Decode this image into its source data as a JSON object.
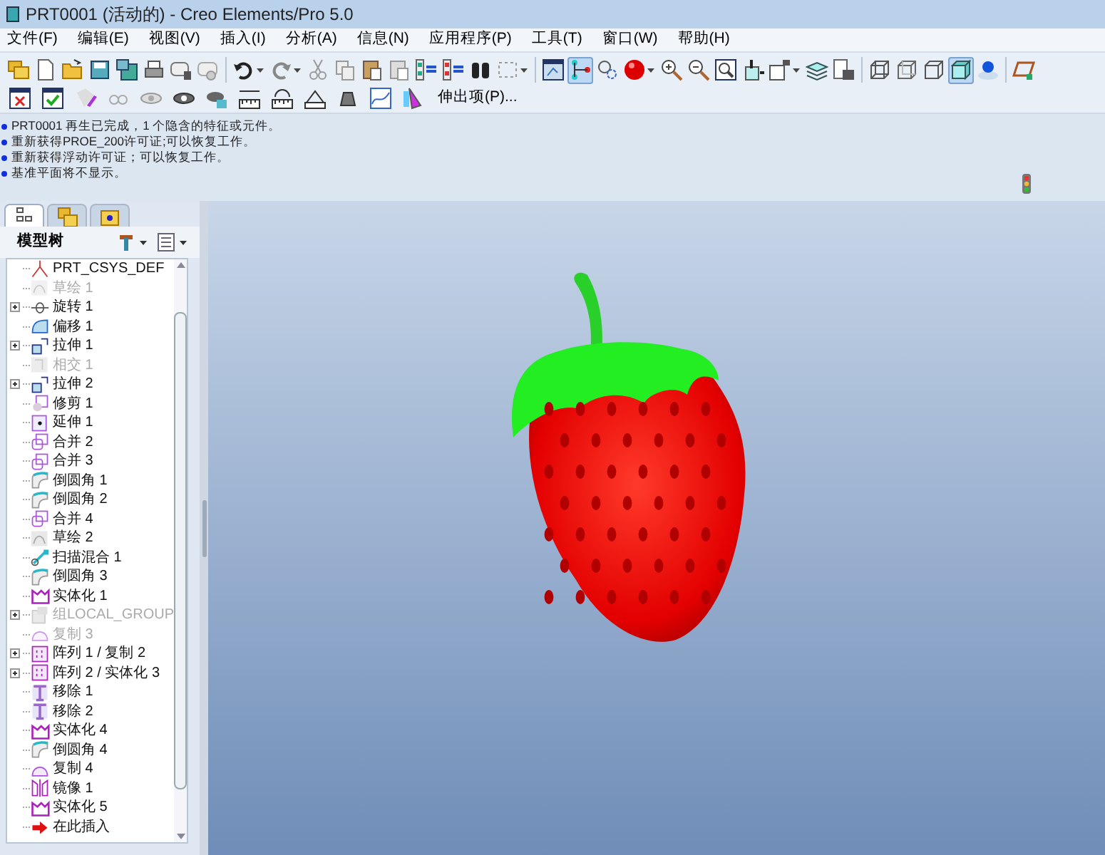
{
  "window": {
    "title": "PRT0001 (活动的) - Creo Elements/Pro 5.0"
  },
  "menu": [
    "文件(F)",
    "编辑(E)",
    "视图(V)",
    "插入(I)",
    "分析(A)",
    "信息(N)",
    "应用程序(P)",
    "工具(T)",
    "窗口(W)",
    "帮助(H)"
  ],
  "toolbar_1": [
    {
      "selected": false
    },
    {
      "selected": false
    },
    {
      "selected": false
    },
    {
      "selected": false
    },
    {
      "selected": false
    },
    {
      "selected": false
    },
    {
      "selected": false
    },
    {
      "selected": false
    },
    {
      "selected": false
    },
    {
      "selected": false
    },
    {
      "selected": false
    },
    {
      "selected": false
    },
    {
      "selected": false
    },
    {
      "selected": false
    },
    {
      "selected": false
    },
    {
      "selected": false
    },
    {
      "selected": false
    },
    {
      "selected": false
    },
    {
      "selected": false
    },
    {
      "selected": true
    },
    {
      "selected": false
    },
    {
      "selected": false
    },
    {
      "selected": false
    },
    {
      "selected": false
    },
    {
      "selected": false
    },
    {
      "selected": false
    },
    {
      "selected": false
    },
    {
      "selected": false
    },
    {
      "selected": false
    },
    {
      "selected": false
    },
    {
      "selected": false
    },
    {
      "selected": false
    },
    {
      "selected": true
    },
    {
      "selected": false
    },
    {
      "selected": false
    }
  ],
  "toolbar_2": {
    "menu_label": "伸出项(P)..."
  },
  "messages": [
    "PRT0001 再生已完成，1 个隐含的特征或元件。",
    "重新获得PROE_200许可证;可以恢复工作。",
    "重新获得浮动许可证；可以恢复工作。",
    "基准平面将不显示。"
  ],
  "model_tree": {
    "title": "模型树",
    "tabs": [
      {
        "selected": true
      },
      {
        "selected": false
      },
      {
        "selected": false
      }
    ],
    "items": [
      {
        "label": "PRT_CSYS_DEF",
        "kind": "csys",
        "expandable": false,
        "disabled": false
      },
      {
        "label": "草绘 1",
        "kind": "sketch",
        "expandable": false,
        "disabled": true
      },
      {
        "label": "旋转 1",
        "kind": "revolve",
        "expandable": true,
        "disabled": false
      },
      {
        "label": "偏移 1",
        "kind": "offset",
        "expandable": false,
        "disabled": false
      },
      {
        "label": "拉伸 1",
        "kind": "extrude",
        "expandable": true,
        "disabled": false
      },
      {
        "label": "相交 1",
        "kind": "intersect",
        "expandable": false,
        "disabled": true
      },
      {
        "label": "拉伸 2",
        "kind": "extrude",
        "expandable": true,
        "disabled": false
      },
      {
        "label": "修剪 1",
        "kind": "trim",
        "expandable": false,
        "disabled": false
      },
      {
        "label": "延伸 1",
        "kind": "extend",
        "expandable": false,
        "disabled": false
      },
      {
        "label": "合并 2",
        "kind": "merge",
        "expandable": false,
        "disabled": false
      },
      {
        "label": "合并 3",
        "kind": "merge",
        "expandable": false,
        "disabled": false
      },
      {
        "label": "倒圆角 1",
        "kind": "round",
        "expandable": false,
        "disabled": false
      },
      {
        "label": "倒圆角 2",
        "kind": "round",
        "expandable": false,
        "disabled": false
      },
      {
        "label": "合并 4",
        "kind": "merge",
        "expandable": false,
        "disabled": false
      },
      {
        "label": "草绘 2",
        "kind": "sketch",
        "expandable": false,
        "disabled": false
      },
      {
        "label": "扫描混合 1",
        "kind": "sweep",
        "expandable": false,
        "disabled": false
      },
      {
        "label": "倒圆角 3",
        "kind": "round",
        "expandable": false,
        "disabled": false
      },
      {
        "label": "实体化 1",
        "kind": "solidify",
        "expandable": false,
        "disabled": false
      },
      {
        "label": "组LOCAL_GROUP",
        "kind": "group",
        "expandable": true,
        "disabled": true
      },
      {
        "label": "复制 3",
        "kind": "copy",
        "expandable": false,
        "disabled": true
      },
      {
        "label": "阵列 1 / 复制 2",
        "kind": "pattern",
        "expandable": true,
        "disabled": false
      },
      {
        "label": "阵列 2 / 实体化 3",
        "kind": "pattern",
        "expandable": true,
        "disabled": false
      },
      {
        "label": "移除 1",
        "kind": "remove",
        "expandable": false,
        "disabled": false
      },
      {
        "label": "移除 2",
        "kind": "remove",
        "expandable": false,
        "disabled": false
      },
      {
        "label": "实体化 4",
        "kind": "solidify",
        "expandable": false,
        "disabled": false
      },
      {
        "label": "倒圆角 4",
        "kind": "round",
        "expandable": false,
        "disabled": false
      },
      {
        "label": "复制 4",
        "kind": "copy",
        "expandable": false,
        "disabled": false
      },
      {
        "label": "镜像 1",
        "kind": "mirror",
        "expandable": false,
        "disabled": false
      },
      {
        "label": "实体化 5",
        "kind": "solidify",
        "expandable": false,
        "disabled": false
      },
      {
        "label": "在此插入",
        "kind": "insert",
        "expandable": false,
        "disabled": false
      }
    ]
  }
}
